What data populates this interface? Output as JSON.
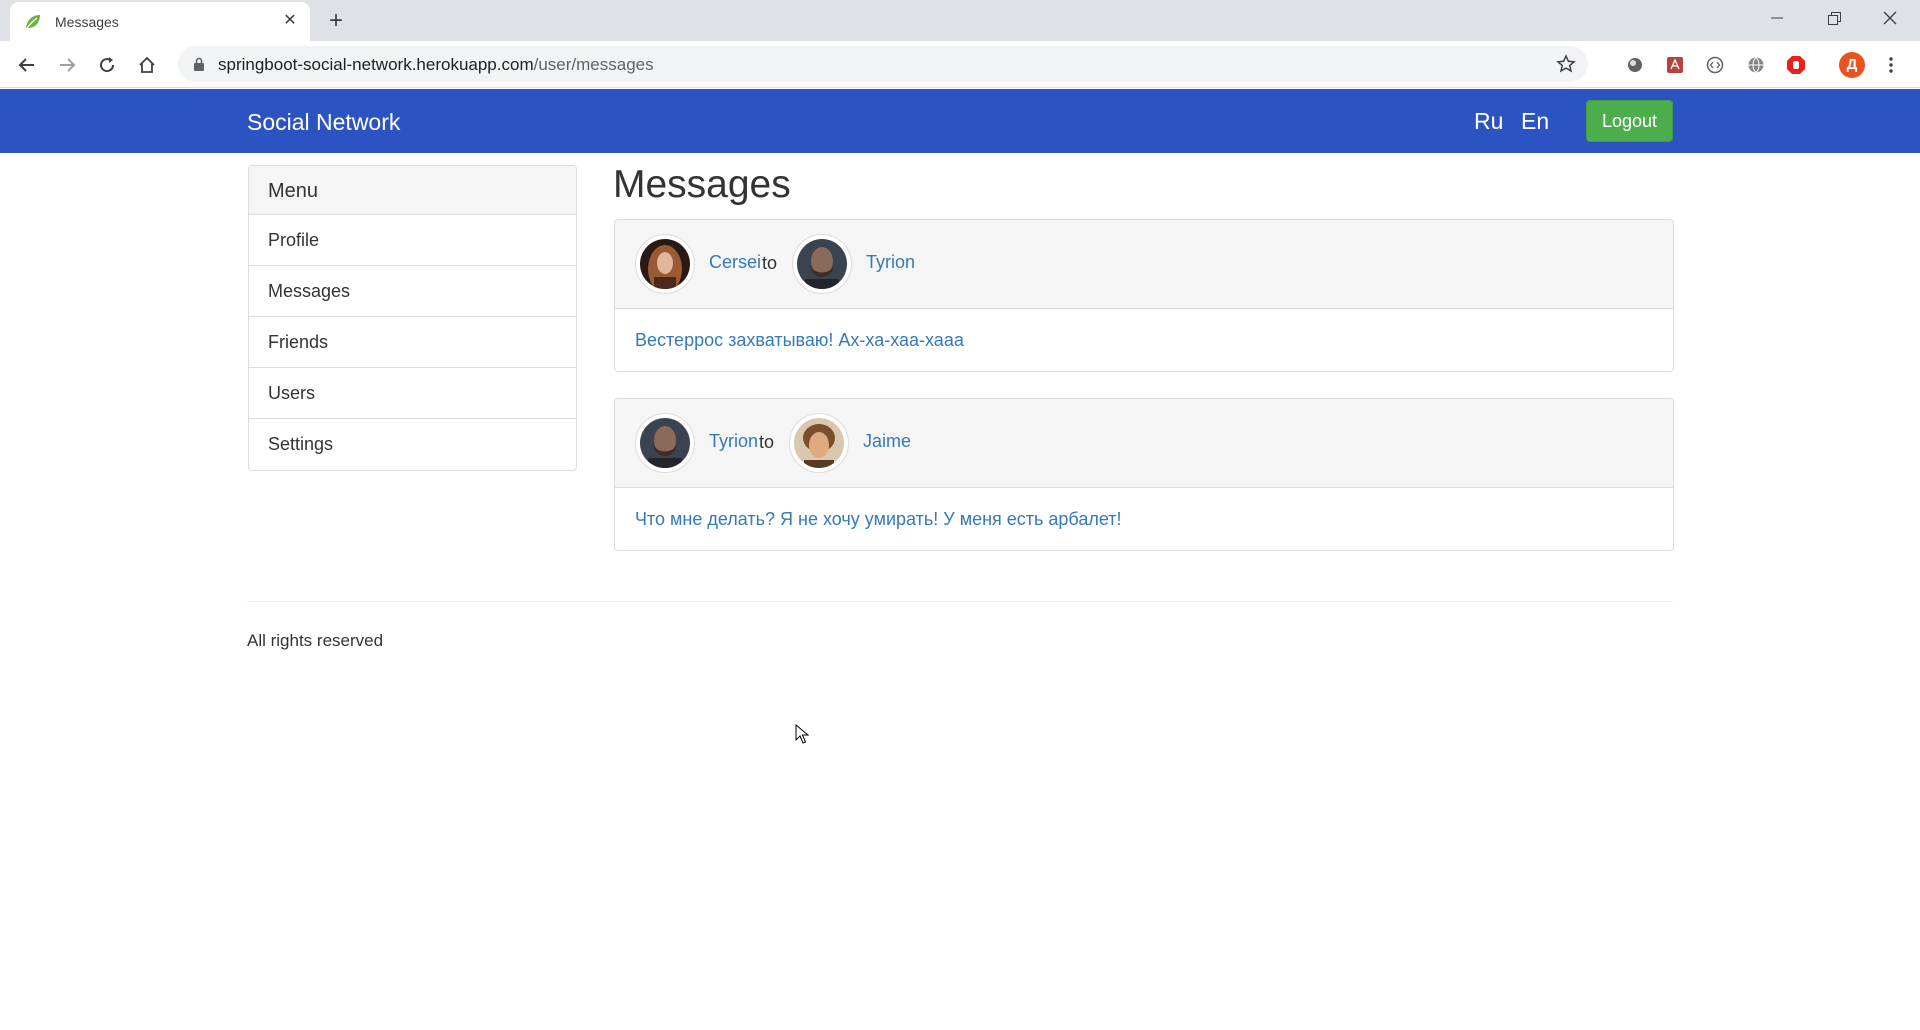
{
  "browser": {
    "tab_title": "Messages",
    "url_host": "springboot-social-network.herokuapp.com",
    "url_path": "/user/messages",
    "profile_initial": "Д"
  },
  "navbar": {
    "brand": "Social Network",
    "lang_ru": "Ru",
    "lang_en": "En",
    "logout_label": "Logout",
    "bg_color": "#2c53c2",
    "logout_color": "#4cae4c"
  },
  "menu": {
    "heading": "Menu",
    "items": [
      {
        "label": "Profile"
      },
      {
        "label": "Messages"
      },
      {
        "label": "Friends"
      },
      {
        "label": "Users"
      },
      {
        "label": "Settings"
      }
    ]
  },
  "page": {
    "title": "Messages"
  },
  "messages": [
    {
      "from": "Cersei",
      "to_word": "to",
      "to": "Tyrion",
      "text": "Вестеррос захватываю! Ах-ха-хаа-хааа"
    },
    {
      "from": "Tyrion",
      "to_word": "to",
      "to": "Jaime",
      "text": "Что мне делать? Я не хочу умирать! У меня есть арбалет!"
    }
  ],
  "footer": {
    "text": "All rights reserved"
  }
}
